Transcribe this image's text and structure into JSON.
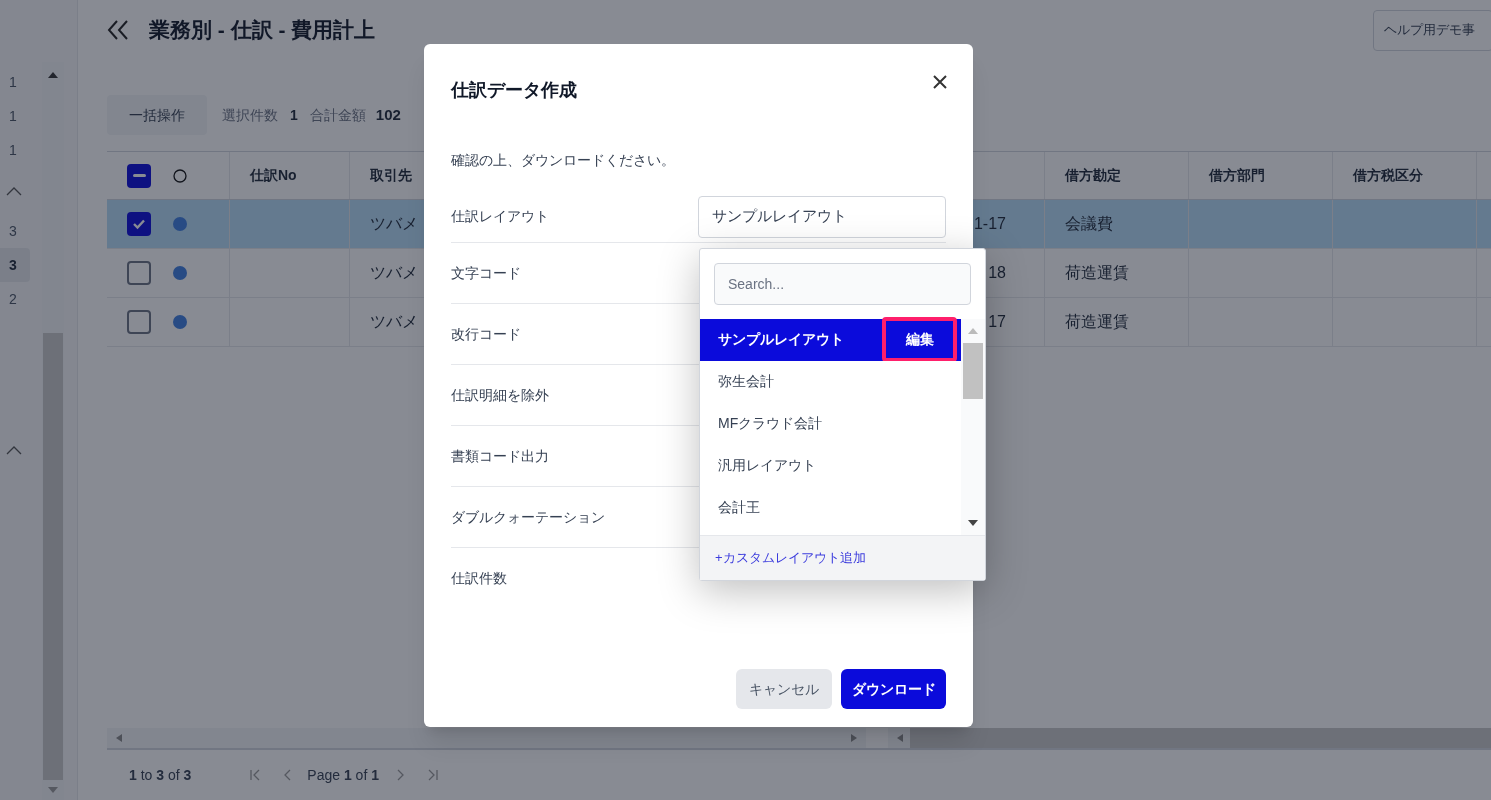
{
  "page": {
    "title": "業務別 - 仕訳 - 費用計上",
    "help_button": "ヘルプ用デモ事"
  },
  "side_list": [
    {
      "kind": "number",
      "label": "1",
      "selected": false
    },
    {
      "kind": "number",
      "label": "1",
      "selected": false
    },
    {
      "kind": "number",
      "label": "1",
      "selected": false
    },
    {
      "kind": "chevron",
      "selected": false
    },
    {
      "kind": "number",
      "label": "3",
      "selected": false
    },
    {
      "kind": "number",
      "label": "3",
      "selected": true
    },
    {
      "kind": "number",
      "label": "2",
      "selected": false
    },
    {
      "kind": "chevron",
      "selected": false
    }
  ],
  "toolbar": {
    "bulk_button": "一括操作",
    "selected_count_label": "選択件数",
    "selected_count": "1",
    "total_label": "合計金額",
    "total": "102"
  },
  "table": {
    "header_checkbox": {
      "checked": true,
      "indeterminate": true
    },
    "columns": [
      "仕訳No",
      "取引先",
      "借方勘定",
      "借方部門",
      "借方税区分"
    ],
    "rows": [
      {
        "selected": true,
        "checked": true,
        "partner": "ツバメ",
        "date": "1-17",
        "debit_account": "会議費"
      },
      {
        "selected": false,
        "checked": false,
        "partner": "ツバメ",
        "date": "18",
        "debit_account": "荷造運賃"
      },
      {
        "selected": false,
        "checked": false,
        "partner": "ツバメ",
        "date": "17",
        "debit_account": "荷造運賃"
      }
    ]
  },
  "pagination": {
    "range": "**1** to **3** of **3**",
    "page": "Page **1** of **1**"
  },
  "modal": {
    "title": "仕訳データ作成",
    "message": "確認の上、ダウンロードください。",
    "fields": [
      {
        "label": "仕訳レイアウト",
        "value": "サンプルレイアウト"
      },
      {
        "label": "文字コード"
      },
      {
        "label": "改行コード"
      },
      {
        "label": "仕訳明細を除外"
      },
      {
        "label": "書類コード出力"
      },
      {
        "label": "ダブルクォーテーション"
      },
      {
        "label": "仕訳件数"
      }
    ],
    "dropdown": {
      "search_placeholder": "Search...",
      "options": [
        {
          "label": "サンプルレイアウト",
          "selected": true,
          "edit_button": "編集",
          "highlighted": true
        },
        {
          "label": "弥生会計",
          "selected": false
        },
        {
          "label": "MFクラウド会計",
          "selected": false
        },
        {
          "label": "汎用レイアウト",
          "selected": false
        },
        {
          "label": "会計王",
          "selected": false
        }
      ],
      "footer_link": "+カスタムレイアウト追加"
    },
    "cancel_button": "キャンセル",
    "download_button": "ダウンロード"
  }
}
